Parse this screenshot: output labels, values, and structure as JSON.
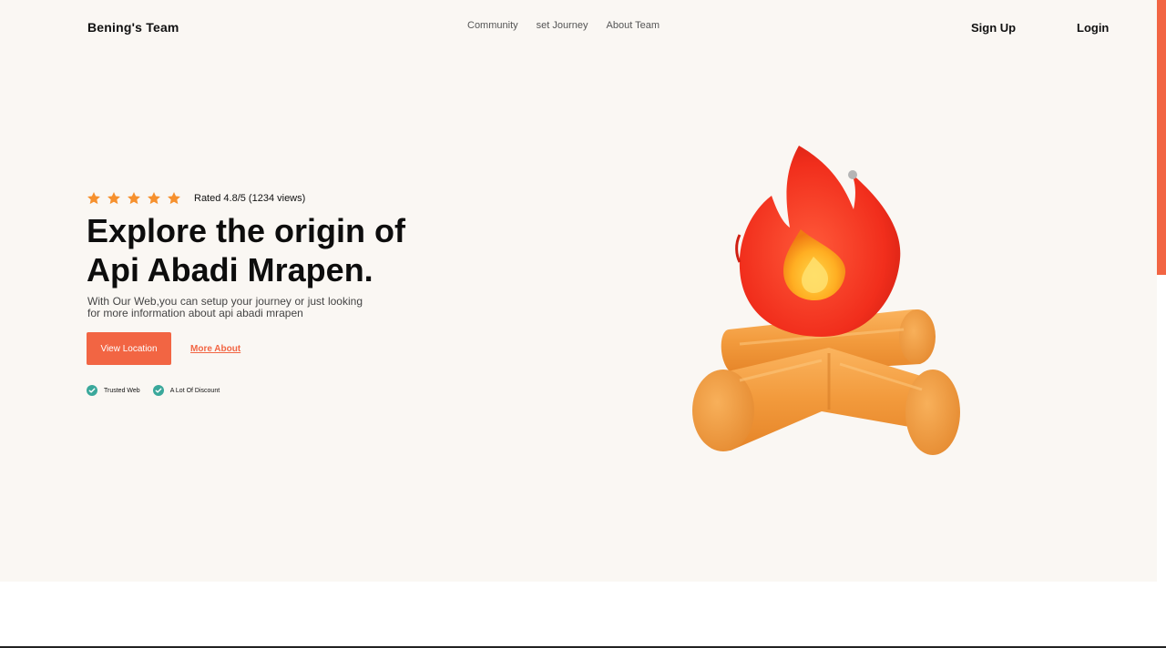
{
  "nav": {
    "brand": "Bening's Team",
    "links": [
      "Community",
      "set Journey",
      "About Team"
    ],
    "sign_up": "Sign Up",
    "login": "Login"
  },
  "hero": {
    "rating": {
      "stars": 5,
      "text": "Rated 4.8/5 (1234 views)"
    },
    "title_line1": "Explore the origin of",
    "title_line2": "Api Abadi Mrapen.",
    "description": "With Our Web,you can setup your journey or just looking for more information about api abadi mrapen",
    "primary_button": "View Location",
    "secondary_link": "More About",
    "features": [
      "Trusted Web",
      "A Lot Of Discount"
    ]
  },
  "colors": {
    "accent": "#f26543",
    "star": "#f6902d",
    "check": "#3aa89b",
    "hero_bg": "#faf7f3"
  },
  "illustration": {
    "icon": "campfire-icon"
  }
}
